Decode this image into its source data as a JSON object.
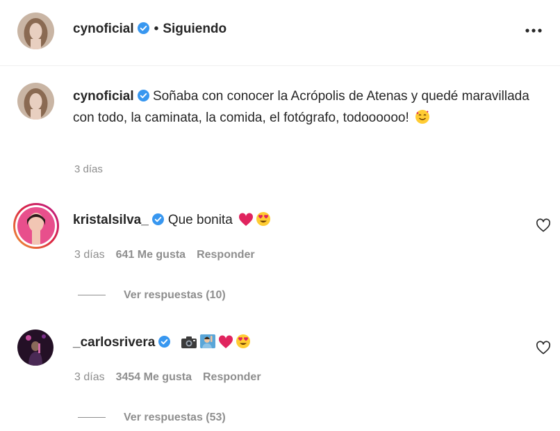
{
  "header": {
    "username": "cynoficial",
    "separator": "•",
    "follow_status": "Siguiendo",
    "more_icon": "more-horizontal-icon"
  },
  "caption": {
    "username": "cynoficial",
    "text": "Soñaba con conocer la Acrópolis de Atenas y quedé maravillada con todo, la caminata, la comida, el fotógrafo, todoooooo!",
    "emoji": "🥰",
    "time": "3 días"
  },
  "comments": [
    {
      "username": "kristalsilva_",
      "text": "Que bonita",
      "emojis": [
        "❤️",
        "😍"
      ],
      "time": "3 días",
      "likes": "641 Me gusta",
      "reply_label": "Responder",
      "view_replies": "Ver respuestas (10)"
    },
    {
      "username": "_carlosrivera",
      "text": "",
      "emojis": [
        "📷",
        "🙋",
        "❤️",
        "😍"
      ],
      "time": "3 días",
      "likes": "3454 Me gusta",
      "reply_label": "Responder",
      "view_replies": "Ver respuestas (53)"
    }
  ],
  "colors": {
    "verified": "#3897f0",
    "secondary_text": "#8e8e8e",
    "primary_text": "#262626",
    "heart_emoji": "#e0245e"
  }
}
